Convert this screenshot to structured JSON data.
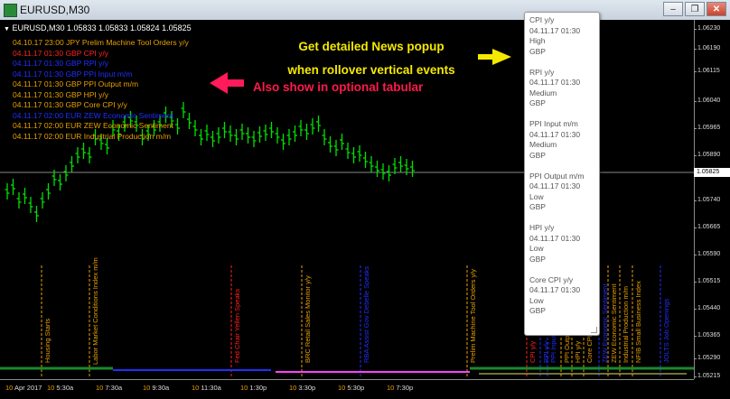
{
  "window": {
    "title": "EURUSD,M30",
    "controls": [
      {
        "name": "minimize-button",
        "glyph": "‒"
      },
      {
        "name": "maximize-button",
        "glyph": "❐"
      },
      {
        "name": "close-button",
        "glyph": "✕"
      }
    ]
  },
  "symbol_bar": {
    "text": "EURUSD,M30  1.05833 1.05833 1.05824 1.05825"
  },
  "news_list": [
    {
      "text": "04.10.17 23:00 JPY Prelim Machine Tool Orders y/y",
      "color": "#e8a000"
    },
    {
      "text": "04.11.17 01:30 GBP CPI y/y",
      "color": "#ff2020"
    },
    {
      "text": "04.11.17 01:30 GBP RPI y/y",
      "color": "#2030ff"
    },
    {
      "text": "04.11.17 01:30 GBP PPI Input m/m",
      "color": "#2030ff"
    },
    {
      "text": "04.11.17 01:30 GBP PPI Output m/m",
      "color": "#e8a000"
    },
    {
      "text": "04.11.17 01:30 GBP HPI y/y",
      "color": "#e8a000"
    },
    {
      "text": "04.11.17 01:30 GBP Core CPI y/y",
      "color": "#e8a000"
    },
    {
      "text": "04.11.17 02:00 EUR ZEW Economic Sentiment",
      "color": "#2030ff"
    },
    {
      "text": "04.11.17 02:00 EUR ZEW Economic Sentiment",
      "color": "#e8a000"
    },
    {
      "text": "04.11.17 02:00 EUR Industrial Production m/m",
      "color": "#e8a000"
    }
  ],
  "annotations": {
    "line1": "Get detailed News popup",
    "line2": "when rollover vertical events",
    "line3": "Also show in optional  tabular",
    "color1": "#f5e900",
    "color2": "#ff1a4a"
  },
  "popup_entries": [
    {
      "title": "CPI y/y",
      "time": "04.11.17 01:30",
      "impact": "High",
      "currency": "GBP"
    },
    {
      "title": "RPI y/y",
      "time": "04.11.17 01:30",
      "impact": "Medium",
      "currency": "GBP"
    },
    {
      "title": "PPI Input m/m",
      "time": "04.11.17 01:30",
      "impact": "Medium",
      "currency": "GBP"
    },
    {
      "title": "PPI Output m/m",
      "time": "04.11.17 01:30",
      "impact": "Low",
      "currency": "GBP"
    },
    {
      "title": "HPI y/y",
      "time": "04.11.17 01:30",
      "impact": "Low",
      "currency": "GBP"
    },
    {
      "title": "Core CPI y/y",
      "time": "04.11.17 01:30",
      "impact": "Low",
      "currency": "GBP"
    }
  ],
  "price_axis": [
    "1.06230",
    "1.06190",
    "1.06115",
    "1.06040",
    "1.05965",
    "1.05890",
    "1.05825",
    "1.05740",
    "1.05665",
    "1.05590",
    "1.05515",
    "1.05440",
    "1.05365",
    "1.05290",
    "1.05215"
  ],
  "current_price": "1.05825",
  "time_axis": [
    {
      "day": "10",
      "label": "Apr 2017"
    },
    {
      "day": "10",
      "label": "5:30a"
    },
    {
      "day": "10",
      "label": "7:30a"
    },
    {
      "day": "10",
      "label": "9:30a"
    },
    {
      "day": "10",
      "label": "11:30a"
    },
    {
      "day": "10",
      "label": "1:30p"
    },
    {
      "day": "10",
      "label": "3:30p"
    },
    {
      "day": "10",
      "label": "5:30p"
    },
    {
      "day": "10",
      "label": "7:30p"
    }
  ],
  "event_lines": [
    {
      "label": "Housing Starts",
      "color": "#e8a000"
    },
    {
      "label": "Labor Market Conditions Index m/m",
      "color": "#e8a000"
    },
    {
      "label": "Fed Chair Yellen Speaks",
      "color": "#ff2020"
    },
    {
      "label": "BRC Retail Sales Monitor y/y",
      "color": "#e8a000"
    },
    {
      "label": "RBA Assist Gov Debelle Speaks",
      "color": "#2030ff"
    },
    {
      "label": "Prelim Machine Tool Orders y/y",
      "color": "#e8a000"
    },
    {
      "label": "CPI y/y",
      "color": "#ff2020"
    },
    {
      "label": "RPI y/y",
      "color": "#2030ff"
    },
    {
      "label": "PPI Input m/m",
      "color": "#2030ff"
    },
    {
      "label": "PPI Output m/m",
      "color": "#e8a000"
    },
    {
      "label": "HPI y/y",
      "color": "#e8a000"
    },
    {
      "label": "Core CPI y/y",
      "color": "#e8a000"
    },
    {
      "label": "ZEW Economic Sentiment",
      "color": "#2030ff"
    },
    {
      "label": "ZEW Economic Sentiment",
      "color": "#e8a000"
    },
    {
      "label": "Industrial Production m/m",
      "color": "#e8a000"
    },
    {
      "label": "NFIB Small Business Index",
      "color": "#e8a000"
    },
    {
      "label": "JOLTS Job Openings",
      "color": "#2030ff"
    }
  ],
  "colors": {
    "candle": "#00e000",
    "background": "#000000",
    "orange": "#e8a000",
    "red": "#ff2020",
    "blue": "#2030ff",
    "pink": "#ff40ff"
  }
}
